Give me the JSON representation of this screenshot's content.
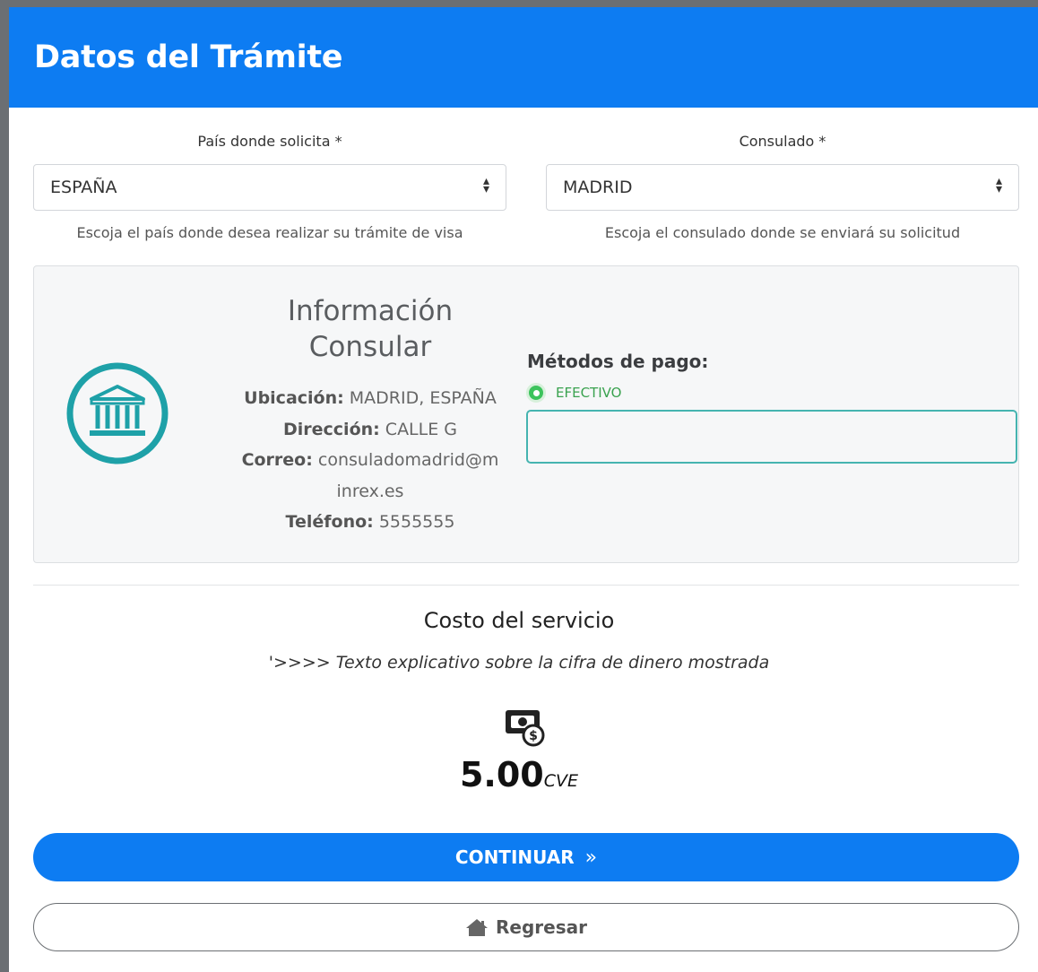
{
  "header": {
    "title": "Datos del Trámite"
  },
  "form": {
    "country": {
      "label": "País donde solicita *",
      "value": "ESPAÑA",
      "help": "Escoja el país donde desea realizar su trámite de visa"
    },
    "consulate": {
      "label": "Consulado *",
      "value": "MADRID",
      "help": "Escoja el consulado donde se enviará su solicitud"
    }
  },
  "info": {
    "title_line1": "Información",
    "title_line2": "Consular",
    "location_label": "Ubicación:",
    "location_value": "MADRID, ESPAÑA",
    "address_label": "Dirección:",
    "address_value": "CALLE G",
    "email_label": "Correo:",
    "email_value_line1": "consuladomadrid@m",
    "email_value_line2": "inrex.es",
    "phone_label": "Teléfono:",
    "phone_value": "5555555",
    "icon": "bank-icon"
  },
  "payment": {
    "title": "Métodos de pago:",
    "selected_method": "EFECTIVO",
    "accent": "#3cc35c"
  },
  "cost": {
    "title": "Costo del servicio",
    "note": "'>>>> Texto explicativo sobre la cifra de dinero mostrada",
    "amount": "5.00",
    "currency": "CVE",
    "icon": "money-icon"
  },
  "actions": {
    "continue_label": "CONTINUAR",
    "continue_icon": "double-chevron-right-icon",
    "back_label": "Regresar",
    "back_icon": "home-icon"
  },
  "colors": {
    "primary": "#0d7cf2",
    "teal": "#1ea1a8",
    "success": "#3cc35c"
  }
}
